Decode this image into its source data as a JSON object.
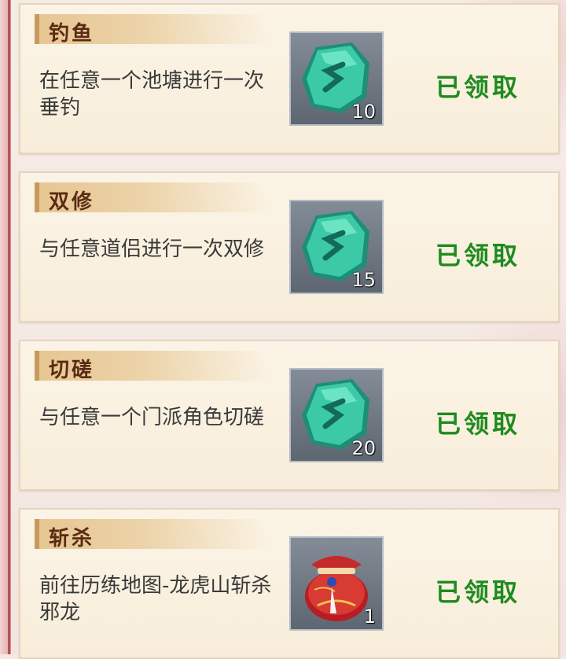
{
  "tasks": [
    {
      "title": "钓鱼",
      "description": "在任意一个池塘进行一次垂钓",
      "reward_icon": "jade-stone-icon",
      "reward_count": "10",
      "status": "已领取"
    },
    {
      "title": "双修",
      "description": "与任意道侣进行一次双修",
      "reward_icon": "jade-stone-icon",
      "reward_count": "15",
      "status": "已领取"
    },
    {
      "title": "切磋",
      "description": "与任意一个门派角色切磋",
      "reward_icon": "jade-stone-icon",
      "reward_count": "20",
      "status": "已领取"
    },
    {
      "title": "斩杀",
      "description": "前往历练地图-龙虎山斩杀邪龙",
      "reward_icon": "red-pouch-icon",
      "reward_count": "1",
      "status": "已领取"
    }
  ],
  "colors": {
    "status_green": "#1f8b1f",
    "title_brown": "#5a2b12",
    "jade": "#2fb497"
  }
}
